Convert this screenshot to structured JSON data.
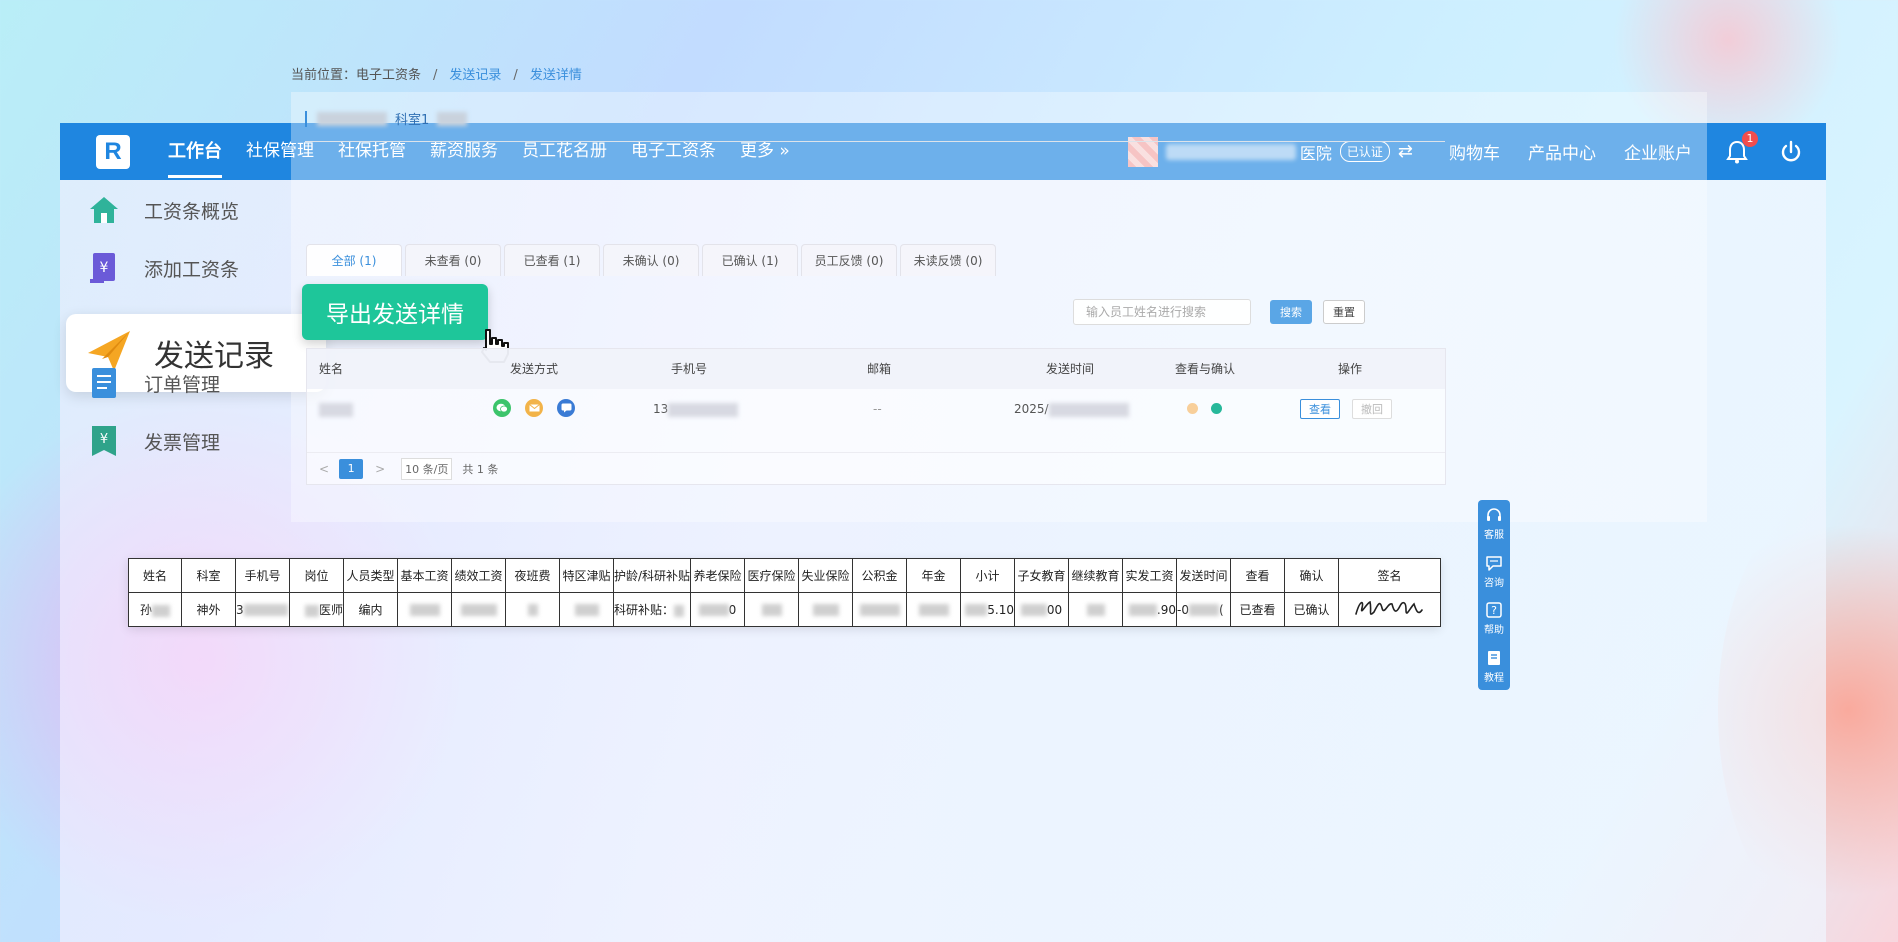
{
  "nav": {
    "logo": "R",
    "items": [
      "工作台",
      "社保管理",
      "社保托管",
      "薪资服务",
      "员工花名册",
      "电子工资条",
      "更多 »"
    ],
    "active_index": 0,
    "hospital": "医院",
    "verified": "已认证",
    "swap": "⇄",
    "links": [
      "购物车",
      "产品中心",
      "企业账户"
    ],
    "notification_count": "1"
  },
  "sidebar": {
    "items": [
      "工资条概览",
      "添加工资条",
      "发送记录",
      "订单管理",
      "发票管理"
    ],
    "active_index": 2
  },
  "breadcrumb": {
    "prefix": "当前位置：电子工资条",
    "sep": "/",
    "link1": "发送记录",
    "link2": "发送详情"
  },
  "subtitle": "科室1",
  "tabs": [
    "全部 (1)",
    "未查看 (0)",
    "已查看 (1)",
    "未确认 (0)",
    "已确认 (1)",
    "员工反馈 (0)",
    "未读反馈 (0)"
  ],
  "export_button": "导出发送详情",
  "search": {
    "placeholder": "输入员工姓名进行搜索",
    "search_label": "搜索",
    "reset_label": "重置"
  },
  "table": {
    "headers": [
      "姓名",
      "发送方式",
      "手机号",
      "邮箱",
      "发送时间",
      "查看与确认",
      "操作"
    ],
    "row": {
      "phone_prefix": "13",
      "email": "--",
      "send_time_prefix": "2025/",
      "view_label": "查看",
      "recall_label": "撤回"
    },
    "colors": {
      "wechat": "#3cc46b",
      "email": "#f2b349",
      "sms": "#3a7bd5",
      "viewed_dot": "#f8cf9a",
      "confirmed_dot": "#27b89a"
    }
  },
  "pager": {
    "prev": "<",
    "page": "1",
    "next": ">",
    "page_size": "10 条/页",
    "total": "共 1 条"
  },
  "sheet": {
    "headers": [
      "姓名",
      "科室",
      "手机号",
      "岗位",
      "人员类型",
      "基本工资",
      "绩效工资",
      "夜班费",
      "特区津贴",
      "护龄/科研补贴",
      "养老保险",
      "医疗保险",
      "失业保险",
      "公积金",
      "年金",
      "小计",
      "子女教育",
      "继续教育",
      "实发工资",
      "发送时间",
      "查看",
      "确认",
      "签名"
    ],
    "row": {
      "name": "孙",
      "dept": "神外",
      "phone": "3",
      "post": "医师",
      "staff_type": "编内",
      "research": "科研补贴：",
      "pension": "0",
      "subtotal": "5.10",
      "child_edu": "00",
      "net_pay": ".90",
      "send_time": "-0",
      "send_time_tail": "(",
      "viewed": "已查看",
      "confirmed": "已确认"
    }
  },
  "float_bar": [
    "客服",
    "咨询",
    "帮助",
    "教程"
  ]
}
